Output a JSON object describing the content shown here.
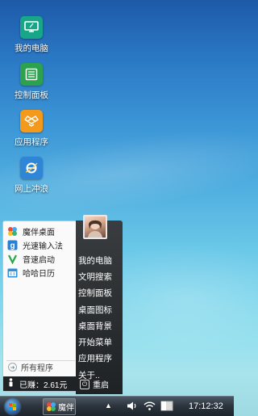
{
  "desktop": {
    "icons": [
      {
        "label": "我的电脑",
        "icon": "computer-monitor-icon",
        "color": "#1aa88a"
      },
      {
        "label": "控制面板",
        "icon": "control-panel-icon",
        "color": "#2ea44f"
      },
      {
        "label": "应用程序",
        "icon": "dropbox-box-icon",
        "color": "#f39a1c"
      },
      {
        "label": "网上冲浪",
        "icon": "internet-explorer-icon",
        "color": "#2f86d6"
      }
    ]
  },
  "start_menu": {
    "pinned": [
      {
        "label": "魔伴桌面",
        "icon": "pinwheel-icon"
      },
      {
        "label": "光速输入法",
        "icon": "input-g-icon"
      },
      {
        "label": "音速启动",
        "icon": "v-launch-icon"
      },
      {
        "label": "哈哈日历",
        "icon": "calendar-icon"
      }
    ],
    "all_programs": "所有程序",
    "earned": "已赚：2.61元",
    "right_items": [
      "我的电脑",
      "文明搜索",
      "控制面板",
      "桌面图标",
      "桌面背景",
      "开始菜单",
      "应用程序",
      "关于.."
    ],
    "restart": "重启"
  },
  "taskbar": {
    "app_label": "魔伴",
    "clock": "17:12:32"
  },
  "colors": {
    "taskbar_dark": "#1d242b",
    "menu_dark": "#1f2225",
    "menu_light": "#fafafa"
  }
}
